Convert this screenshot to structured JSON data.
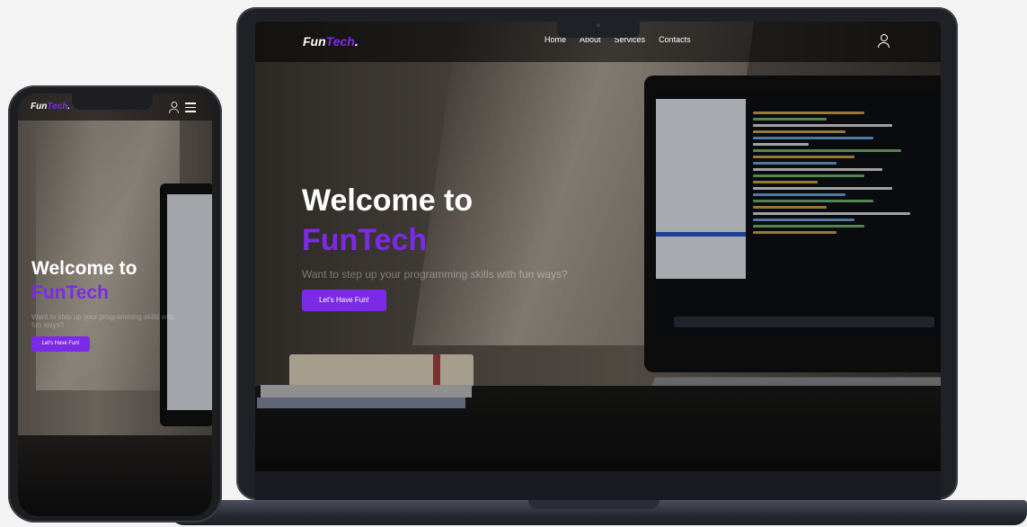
{
  "site": {
    "logo_main": "Fun",
    "logo_accent": "Tech",
    "logo_dot": "."
  },
  "nav": {
    "items": [
      "Home",
      "About",
      "Services",
      "Contacts"
    ]
  },
  "hero": {
    "welcome": "Welcome to",
    "brand": "FunTech",
    "subtitle": "Want to step up your programming skills with fun ways?",
    "cta": "Let's Have Fun!"
  },
  "colors": {
    "accent": "#7d2ae8",
    "nav_text": "#ffffff"
  },
  "icons": {
    "user": "user-icon",
    "menu": "hamburger-menu-icon"
  }
}
